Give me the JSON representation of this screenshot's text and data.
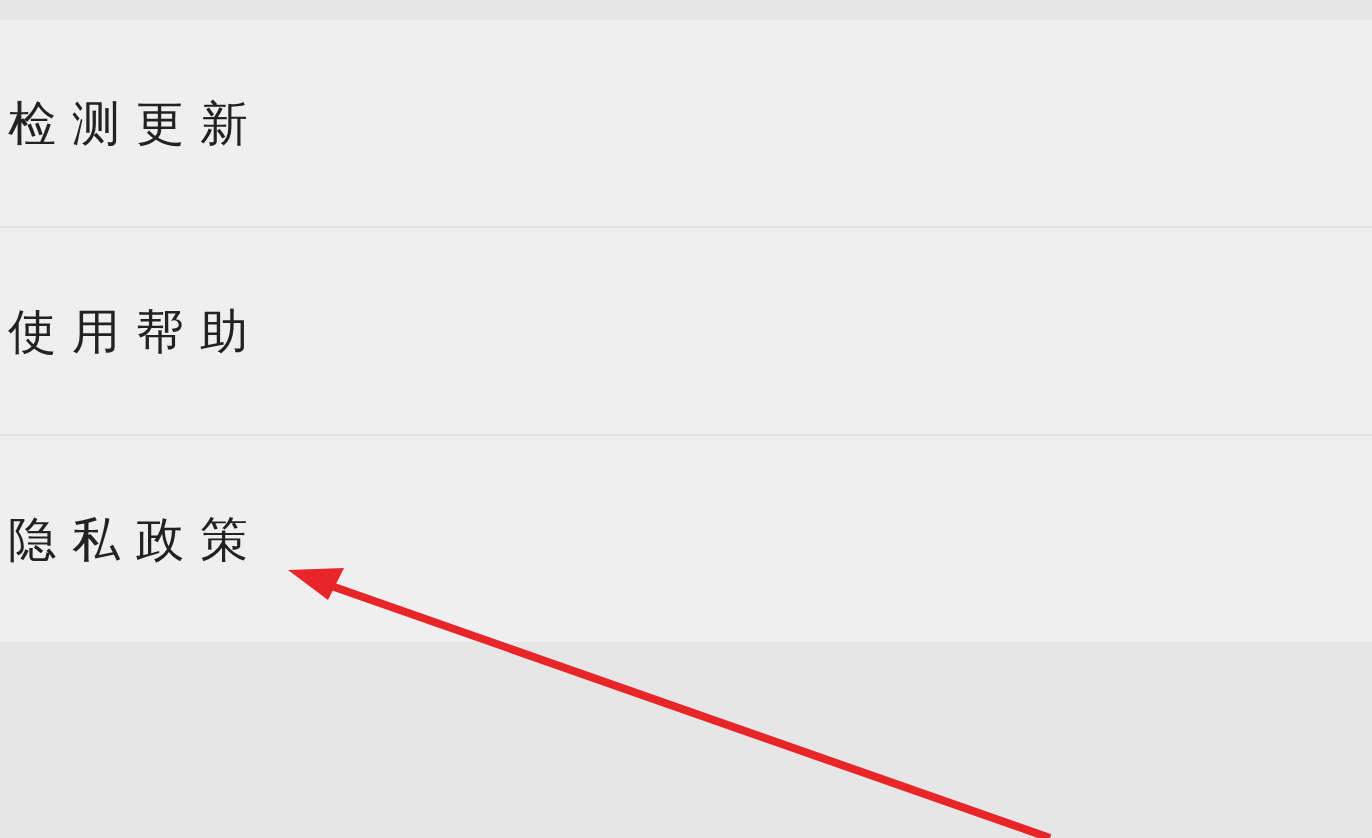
{
  "menu_items": [
    {
      "label": "检测更新"
    },
    {
      "label": "使用帮助"
    },
    {
      "label": "隐私政策"
    }
  ]
}
